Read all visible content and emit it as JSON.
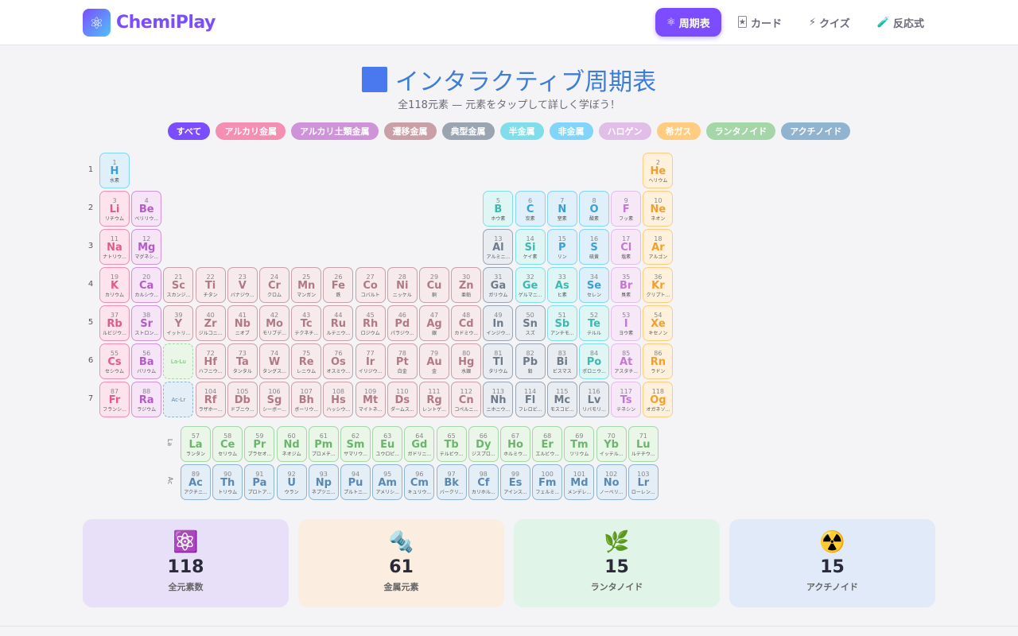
{
  "brand": {
    "name": "ChemiPlay",
    "logo_icon": "atom-icon"
  },
  "nav": [
    {
      "icon": "⚛",
      "label": "周期表",
      "active": true
    },
    {
      "icon": "🃏",
      "label": "カード",
      "active": false
    },
    {
      "icon": "⚡",
      "label": "クイズ",
      "active": false
    },
    {
      "icon": "🧪",
      "label": "反応式",
      "active": false
    }
  ],
  "title": "インタラクティブ周期表",
  "subtitle": "全118元素 — 元素をタップして詳しく学ぼう！",
  "filters": [
    {
      "label": "すべて",
      "color": "#7c4dff"
    },
    {
      "label": "アルカリ金属",
      "color": "#f48fb1"
    },
    {
      "label": "アルカリ土類金属",
      "color": "#ce93d8"
    },
    {
      "label": "遷移金属",
      "color": "#c9a0a8"
    },
    {
      "label": "典型金属",
      "color": "#9aa5b1"
    },
    {
      "label": "半金属",
      "color": "#80deea"
    },
    {
      "label": "非金属",
      "color": "#81d4fa"
    },
    {
      "label": "ハロゲン",
      "color": "#e1bee7"
    },
    {
      "label": "希ガス",
      "color": "#ffcc80"
    },
    {
      "label": "ランタノイド",
      "color": "#a5d6a7"
    },
    {
      "label": "アクチノイド",
      "color": "#90b4d0"
    }
  ],
  "periods": [
    "1",
    "2",
    "3",
    "4",
    "5",
    "6",
    "7"
  ],
  "series_labels": {
    "lanthanide": "La",
    "actinide": "Ac"
  },
  "placeholders": {
    "lanthanide": "La-Lu",
    "actinide": "Ac-Lr"
  },
  "elements": [
    {
      "n": 1,
      "s": "H",
      "jp": "水素",
      "c": "nonmetal"
    },
    {
      "n": 2,
      "s": "He",
      "jp": "ヘリウム",
      "c": "noble"
    },
    {
      "n": 3,
      "s": "Li",
      "jp": "リチウム",
      "c": "alkali"
    },
    {
      "n": 4,
      "s": "Be",
      "jp": "ベリリウ...",
      "c": "alkaline"
    },
    {
      "n": 5,
      "s": "B",
      "jp": "ホウ素",
      "c": "metalloid"
    },
    {
      "n": 6,
      "s": "C",
      "jp": "炭素",
      "c": "nonmetal"
    },
    {
      "n": 7,
      "s": "N",
      "jp": "窒素",
      "c": "nonmetal"
    },
    {
      "n": 8,
      "s": "O",
      "jp": "酸素",
      "c": "nonmetal"
    },
    {
      "n": 9,
      "s": "F",
      "jp": "フッ素",
      "c": "halogen"
    },
    {
      "n": 10,
      "s": "Ne",
      "jp": "ネオン",
      "c": "noble"
    },
    {
      "n": 11,
      "s": "Na",
      "jp": "ナトリウ...",
      "c": "alkali"
    },
    {
      "n": 12,
      "s": "Mg",
      "jp": "マグネシ...",
      "c": "alkaline"
    },
    {
      "n": 13,
      "s": "Al",
      "jp": "アルミニ...",
      "c": "post"
    },
    {
      "n": 14,
      "s": "Si",
      "jp": "ケイ素",
      "c": "metalloid"
    },
    {
      "n": 15,
      "s": "P",
      "jp": "リン",
      "c": "nonmetal"
    },
    {
      "n": 16,
      "s": "S",
      "jp": "硫黄",
      "c": "nonmetal"
    },
    {
      "n": 17,
      "s": "Cl",
      "jp": "塩素",
      "c": "halogen"
    },
    {
      "n": 18,
      "s": "Ar",
      "jp": "アルゴン",
      "c": "noble"
    },
    {
      "n": 19,
      "s": "K",
      "jp": "カリウム",
      "c": "alkali"
    },
    {
      "n": 20,
      "s": "Ca",
      "jp": "カルシウ...",
      "c": "alkaline"
    },
    {
      "n": 21,
      "s": "Sc",
      "jp": "スカンジ...",
      "c": "transition"
    },
    {
      "n": 22,
      "s": "Ti",
      "jp": "チタン",
      "c": "transition"
    },
    {
      "n": 23,
      "s": "V",
      "jp": "バナジウ...",
      "c": "transition"
    },
    {
      "n": 24,
      "s": "Cr",
      "jp": "クロム",
      "c": "transition"
    },
    {
      "n": 25,
      "s": "Mn",
      "jp": "マンガン",
      "c": "transition"
    },
    {
      "n": 26,
      "s": "Fe",
      "jp": "鉄",
      "c": "transition"
    },
    {
      "n": 27,
      "s": "Co",
      "jp": "コバルト",
      "c": "transition"
    },
    {
      "n": 28,
      "s": "Ni",
      "jp": "ニッケル",
      "c": "transition"
    },
    {
      "n": 29,
      "s": "Cu",
      "jp": "銅",
      "c": "transition"
    },
    {
      "n": 30,
      "s": "Zn",
      "jp": "亜鉛",
      "c": "transition"
    },
    {
      "n": 31,
      "s": "Ga",
      "jp": "ガリウム",
      "c": "post"
    },
    {
      "n": 32,
      "s": "Ge",
      "jp": "ゲルマニ...",
      "c": "metalloid"
    },
    {
      "n": 33,
      "s": "As",
      "jp": "ヒ素",
      "c": "metalloid"
    },
    {
      "n": 34,
      "s": "Se",
      "jp": "セレン",
      "c": "nonmetal"
    },
    {
      "n": 35,
      "s": "Br",
      "jp": "臭素",
      "c": "halogen"
    },
    {
      "n": 36,
      "s": "Kr",
      "jp": "クリプト...",
      "c": "noble"
    },
    {
      "n": 37,
      "s": "Rb",
      "jp": "ルビジウ...",
      "c": "alkali"
    },
    {
      "n": 38,
      "s": "Sr",
      "jp": "ストロン...",
      "c": "alkaline"
    },
    {
      "n": 39,
      "s": "Y",
      "jp": "イットリ...",
      "c": "transition"
    },
    {
      "n": 40,
      "s": "Zr",
      "jp": "ジルコニ...",
      "c": "transition"
    },
    {
      "n": 41,
      "s": "Nb",
      "jp": "ニオブ",
      "c": "transition"
    },
    {
      "n": 42,
      "s": "Mo",
      "jp": "モリブデ...",
      "c": "transition"
    },
    {
      "n": 43,
      "s": "Tc",
      "jp": "テクネチ...",
      "c": "transition"
    },
    {
      "n": 44,
      "s": "Ru",
      "jp": "ルテニウ...",
      "c": "transition"
    },
    {
      "n": 45,
      "s": "Rh",
      "jp": "ロジウム",
      "c": "transition"
    },
    {
      "n": 46,
      "s": "Pd",
      "jp": "パラジウ...",
      "c": "transition"
    },
    {
      "n": 47,
      "s": "Ag",
      "jp": "銀",
      "c": "transition"
    },
    {
      "n": 48,
      "s": "Cd",
      "jp": "カドミウ...",
      "c": "transition"
    },
    {
      "n": 49,
      "s": "In",
      "jp": "インジウ...",
      "c": "post"
    },
    {
      "n": 50,
      "s": "Sn",
      "jp": "スズ",
      "c": "post"
    },
    {
      "n": 51,
      "s": "Sb",
      "jp": "アンチモ...",
      "c": "metalloid"
    },
    {
      "n": 52,
      "s": "Te",
      "jp": "テルル",
      "c": "metalloid"
    },
    {
      "n": 53,
      "s": "I",
      "jp": "ヨウ素",
      "c": "halogen"
    },
    {
      "n": 54,
      "s": "Xe",
      "jp": "キセノン",
      "c": "noble"
    },
    {
      "n": 55,
      "s": "Cs",
      "jp": "セシウム",
      "c": "alkali"
    },
    {
      "n": 56,
      "s": "Ba",
      "jp": "バリウム",
      "c": "alkaline"
    },
    {
      "n": 72,
      "s": "Hf",
      "jp": "ハフニウ...",
      "c": "transition"
    },
    {
      "n": 73,
      "s": "Ta",
      "jp": "タンタル",
      "c": "transition"
    },
    {
      "n": 74,
      "s": "W",
      "jp": "タングス...",
      "c": "transition"
    },
    {
      "n": 75,
      "s": "Re",
      "jp": "レニウム",
      "c": "transition"
    },
    {
      "n": 76,
      "s": "Os",
      "jp": "オスミウ...",
      "c": "transition"
    },
    {
      "n": 77,
      "s": "Ir",
      "jp": "イリジウ...",
      "c": "transition"
    },
    {
      "n": 78,
      "s": "Pt",
      "jp": "白金",
      "c": "transition"
    },
    {
      "n": 79,
      "s": "Au",
      "jp": "金",
      "c": "transition"
    },
    {
      "n": 80,
      "s": "Hg",
      "jp": "水銀",
      "c": "transition"
    },
    {
      "n": 81,
      "s": "Tl",
      "jp": "タリウム",
      "c": "post"
    },
    {
      "n": 82,
      "s": "Pb",
      "jp": "鉛",
      "c": "post"
    },
    {
      "n": 83,
      "s": "Bi",
      "jp": "ビスマス",
      "c": "post"
    },
    {
      "n": 84,
      "s": "Po",
      "jp": "ポロニウ...",
      "c": "metalloid"
    },
    {
      "n": 85,
      "s": "At",
      "jp": "アスタチ...",
      "c": "halogen"
    },
    {
      "n": 86,
      "s": "Rn",
      "jp": "ラドン",
      "c": "noble"
    },
    {
      "n": 87,
      "s": "Fr",
      "jp": "フランシ...",
      "c": "alkali"
    },
    {
      "n": 88,
      "s": "Ra",
      "jp": "ラジウム",
      "c": "alkaline"
    },
    {
      "n": 104,
      "s": "Rf",
      "jp": "ラザホー...",
      "c": "transition"
    },
    {
      "n": 105,
      "s": "Db",
      "jp": "ドブニウ...",
      "c": "transition"
    },
    {
      "n": 106,
      "s": "Sg",
      "jp": "シーボー...",
      "c": "transition"
    },
    {
      "n": 107,
      "s": "Bh",
      "jp": "ボーリウ...",
      "c": "transition"
    },
    {
      "n": 108,
      "s": "Hs",
      "jp": "ハッシウ...",
      "c": "transition"
    },
    {
      "n": 109,
      "s": "Mt",
      "jp": "マイトネ...",
      "c": "transition"
    },
    {
      "n": 110,
      "s": "Ds",
      "jp": "ダームス...",
      "c": "transition"
    },
    {
      "n": 111,
      "s": "Rg",
      "jp": "レントゲ...",
      "c": "transition"
    },
    {
      "n": 112,
      "s": "Cn",
      "jp": "コペルニ...",
      "c": "transition"
    },
    {
      "n": 113,
      "s": "Nh",
      "jp": "ニホニウ...",
      "c": "post"
    },
    {
      "n": 114,
      "s": "Fl",
      "jp": "フレロビ...",
      "c": "post"
    },
    {
      "n": 115,
      "s": "Mc",
      "jp": "モスコビ...",
      "c": "post"
    },
    {
      "n": 116,
      "s": "Lv",
      "jp": "リバモリ...",
      "c": "post"
    },
    {
      "n": 117,
      "s": "Ts",
      "jp": "テネシン",
      "c": "halogen"
    },
    {
      "n": 118,
      "s": "Og",
      "jp": "オガネソ...",
      "c": "noble"
    }
  ],
  "lanthanides": [
    {
      "n": 57,
      "s": "La",
      "jp": "ランタン"
    },
    {
      "n": 58,
      "s": "Ce",
      "jp": "セリウム"
    },
    {
      "n": 59,
      "s": "Pr",
      "jp": "プラセオ..."
    },
    {
      "n": 60,
      "s": "Nd",
      "jp": "ネオジム"
    },
    {
      "n": 61,
      "s": "Pm",
      "jp": "プロメチ..."
    },
    {
      "n": 62,
      "s": "Sm",
      "jp": "サマリウ..."
    },
    {
      "n": 63,
      "s": "Eu",
      "jp": "ユウロピ..."
    },
    {
      "n": 64,
      "s": "Gd",
      "jp": "ガドリニ..."
    },
    {
      "n": 65,
      "s": "Tb",
      "jp": "テルビウ..."
    },
    {
      "n": 66,
      "s": "Dy",
      "jp": "ジスプロ..."
    },
    {
      "n": 67,
      "s": "Ho",
      "jp": "ホルミウ..."
    },
    {
      "n": 68,
      "s": "Er",
      "jp": "エルビウ..."
    },
    {
      "n": 69,
      "s": "Tm",
      "jp": "ツリウム"
    },
    {
      "n": 70,
      "s": "Yb",
      "jp": "イッテル..."
    },
    {
      "n": 71,
      "s": "Lu",
      "jp": "ルテチウ..."
    }
  ],
  "actinides": [
    {
      "n": 89,
      "s": "Ac",
      "jp": "アクチニ..."
    },
    {
      "n": 90,
      "s": "Th",
      "jp": "トリウム"
    },
    {
      "n": 91,
      "s": "Pa",
      "jp": "プロトア..."
    },
    {
      "n": 92,
      "s": "U",
      "jp": "ウラン"
    },
    {
      "n": 93,
      "s": "Np",
      "jp": "ネプツニ..."
    },
    {
      "n": 94,
      "s": "Pu",
      "jp": "プルトニ..."
    },
    {
      "n": 95,
      "s": "Am",
      "jp": "アメリシ..."
    },
    {
      "n": 96,
      "s": "Cm",
      "jp": "キュリウ..."
    },
    {
      "n": 97,
      "s": "Bk",
      "jp": "バークリ..."
    },
    {
      "n": 98,
      "s": "Cf",
      "jp": "カリホル..."
    },
    {
      "n": 99,
      "s": "Es",
      "jp": "アインス..."
    },
    {
      "n": 100,
      "s": "Fm",
      "jp": "フェルミ..."
    },
    {
      "n": 101,
      "s": "Md",
      "jp": "メンデレ..."
    },
    {
      "n": 102,
      "s": "No",
      "jp": "ノーベリ..."
    },
    {
      "n": 103,
      "s": "Lr",
      "jp": "ローレン..."
    }
  ],
  "category_colors": {
    "alkali": {
      "bg": "#fde4ec",
      "border": "#f48fb1",
      "text": "#e05a8a"
    },
    "alkaline": {
      "bg": "#f6e4f7",
      "border": "#ce93d8",
      "text": "#b35cc6"
    },
    "transition": {
      "bg": "#f6eaec",
      "border": "#c9a0a8",
      "text": "#b07a85"
    },
    "post": {
      "bg": "#e9ecf1",
      "border": "#9aa5b1",
      "text": "#6e7b8a"
    },
    "metalloid": {
      "bg": "#dff6f5",
      "border": "#80deea",
      "text": "#3fb8b0"
    },
    "nonmetal": {
      "bg": "#dff0fb",
      "border": "#81d4fa",
      "text": "#3a9fd6"
    },
    "halogen": {
      "bg": "#f7e8f8",
      "border": "#e1bee7",
      "text": "#c27ad0"
    },
    "noble": {
      "bg": "#fff1dc",
      "border": "#ffcc80",
      "text": "#f0a030"
    },
    "lanthanide": {
      "bg": "#eaf6e8",
      "border": "#a5d6a7",
      "text": "#6bb56e"
    },
    "actinide": {
      "bg": "#e4eef7",
      "border": "#90b4d0",
      "text": "#5a88b0"
    }
  },
  "stats": [
    {
      "icon": "⚛️",
      "value": "118",
      "label": "全元素数",
      "bg": "#e8e0f8"
    },
    {
      "icon": "🔩",
      "value": "61",
      "label": "金属元素",
      "bg": "#fbeee0"
    },
    {
      "icon": "🌿",
      "value": "15",
      "label": "ランタノイド",
      "bg": "#e0f5e8"
    },
    {
      "icon": "☢️",
      "value": "15",
      "label": "アクチノイド",
      "bg": "#e0eaf8"
    }
  ]
}
